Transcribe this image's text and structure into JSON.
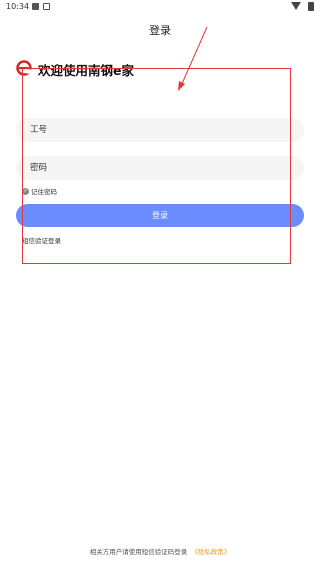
{
  "status_bar": {
    "time": "10:34"
  },
  "header": {
    "title": "登录"
  },
  "app": {
    "welcome": "欢迎使用南钢e家"
  },
  "form": {
    "employee_placeholder": "工号",
    "password_placeholder": "密码",
    "remember_label": "记住密码",
    "login_label": "登录",
    "sms_login_label": "短信验证登录"
  },
  "footer": {
    "notice": "相关方用户请使用短信验证码登录",
    "privacy_label": "《隐私政策》"
  },
  "colors": {
    "primary_button": "#6b8cff",
    "annotation_red": "#e0383e",
    "privacy_link": "#e0a030",
    "logo_red": "#d9262c"
  }
}
